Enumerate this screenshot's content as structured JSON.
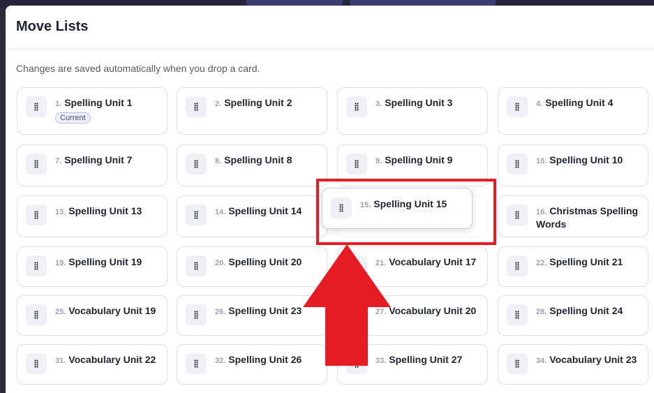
{
  "modal": {
    "title": "Move Lists",
    "hint": "Changes are saved automatically when you drop a card.",
    "current_badge": "Current"
  },
  "cards": [
    {
      "num": "1.",
      "title": "Spelling Unit 1",
      "badge": true
    },
    {
      "num": "2.",
      "title": "Spelling Unit 2"
    },
    {
      "num": "3.",
      "title": "Spelling Unit 3"
    },
    {
      "num": "4.",
      "title": "Spelling Unit 4"
    },
    {
      "num": "7.",
      "title": "Spelling Unit 7"
    },
    {
      "num": "8.",
      "title": "Spelling Unit 8"
    },
    {
      "num": "9.",
      "title": "Spelling Unit 9"
    },
    {
      "num": "10.",
      "title": "Spelling Unit 10"
    },
    {
      "num": "13.",
      "title": "Spelling Unit 13"
    },
    {
      "num": "14.",
      "title": "Spelling Unit 14"
    },
    {
      "num": "15.",
      "title": "Spelling Unit 15",
      "ghost": true
    },
    {
      "num": "16.",
      "title": "Christmas Spelling Words"
    },
    {
      "num": "19.",
      "title": "Spelling Unit 19"
    },
    {
      "num": "20.",
      "title": "Spelling Unit 20"
    },
    {
      "num": "21.",
      "title": "Vocabulary Unit 17"
    },
    {
      "num": "22.",
      "title": "Spelling Unit 21"
    },
    {
      "num": "25.",
      "title": "Vocabulary Unit 19"
    },
    {
      "num": "26.",
      "title": "Spelling Unit 23"
    },
    {
      "num": "27.",
      "title": "Vocabulary Unit 20"
    },
    {
      "num": "28.",
      "title": "Spelling Unit 24"
    },
    {
      "num": "31.",
      "title": "Vocabulary Unit 22"
    },
    {
      "num": "32.",
      "title": "Spelling Unit 26"
    },
    {
      "num": "33.",
      "title": "Spelling Unit 27"
    },
    {
      "num": "34.",
      "title": "Vocabulary Unit 23"
    }
  ],
  "dragging": {
    "num": "15.",
    "title": "Spelling Unit 15"
  },
  "colors": {
    "highlight": "#e61b24",
    "arrow": "#e61b24"
  }
}
